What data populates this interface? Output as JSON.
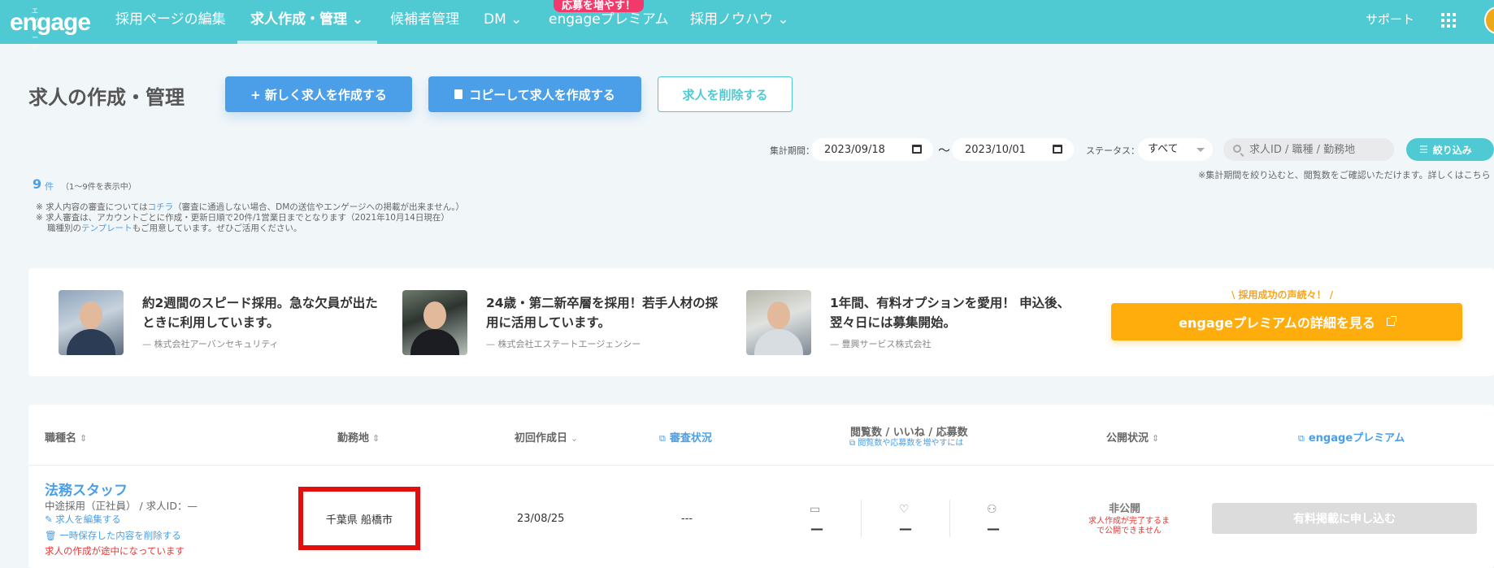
{
  "nav": {
    "logo_small": "エンゲージ",
    "logo": "engage",
    "items": [
      {
        "label": "採用ページの編集"
      },
      {
        "label": "求人作成・管理 ⌄"
      },
      {
        "label": "候補者管理"
      },
      {
        "label": "DM ⌄"
      },
      {
        "label": "engageプレミアム"
      },
      {
        "label": "採用ノウハウ ⌄"
      }
    ],
    "promo_badge": "応募を増やす！",
    "support": "サポート",
    "accent_color": "#4fcad3"
  },
  "header": {
    "title": "求人の作成・管理",
    "new_button": "+ 新しく求人を作成する",
    "copy_button": "コピーして求人を作成する",
    "delete_button": "求人を削除する"
  },
  "filters": {
    "period_label": "集計期間：",
    "start_date": "2023/09/18",
    "end_date": "2023/10/01",
    "tilde": "〜",
    "status_label": "ステータス：",
    "status_value": "すべて",
    "search_placeholder": "求人ID / 職種 / 勤務地",
    "filter_button": "絞り込み",
    "note": "※集計期間を絞り込むと、閲覧数をご確認いただけます。詳しくはこちら"
  },
  "count": {
    "number": "9",
    "unit": "件",
    "range": "（1〜9件を表示中）"
  },
  "notes": {
    "line1_pre": "※ 求人内容の審査については",
    "line1_link": "コチラ",
    "line1_post": "（審査に通過しない場合、DMの送信やエンゲージへの掲載が出来ません。）",
    "line2": "※ 求人審査は、アカウントごとに作成・更新日順で20件/1営業日までとなります（2021年10月14日現在）",
    "line3_pre": "職種別の",
    "line3_link": "テンプレート",
    "line3_post": "もご用意しています。ぜひご活用ください。"
  },
  "testimonials": [
    {
      "quote": "約2週間のスピード採用。急な欠員が出たときに利用しています。",
      "company": "— 株式会社アーバンセキュリティ"
    },
    {
      "quote": "24歳・第二新卒層を採用！若手人材の採用に活用しています。",
      "company": "— 株式会社エステートエージェンシー"
    },
    {
      "quote": "1年間、有料オプションを愛用！ 申込後、翌々日には募集開始。",
      "company": "— 豊興サービス株式会社"
    }
  ],
  "premium": {
    "catch": "\\ 採用成功の声続々！ /",
    "button": "engageプレミアムの詳細を見る",
    "color": "#ffad0d"
  },
  "table": {
    "headers": {
      "job": "職種名",
      "location": "勤務地",
      "created": "初回作成日",
      "review": "審査状況",
      "stats": "閲覧数 / いいね / 応募数",
      "stats_sub": "閲覧数や応募数を増やすには",
      "public": "公開状況",
      "premium": "engageプレミアム"
    },
    "rows": [
      {
        "title": "法務スタッフ",
        "sub": "中途採用（正社員）  /  求人ID：—",
        "edit_link": "✎ 求人を編集する",
        "delete_link": "🗑 一時保存した内容を削除する",
        "warning": "求人の作成が途中になっています",
        "location": "千葉県 船橋市",
        "created": "23/08/25",
        "review": "---",
        "views": "—",
        "likes": "—",
        "applies": "—",
        "public": "非公開",
        "public_note": "求人作成が完了するまで公開できません",
        "apply_button": "有料掲載に申し込む"
      }
    ]
  }
}
